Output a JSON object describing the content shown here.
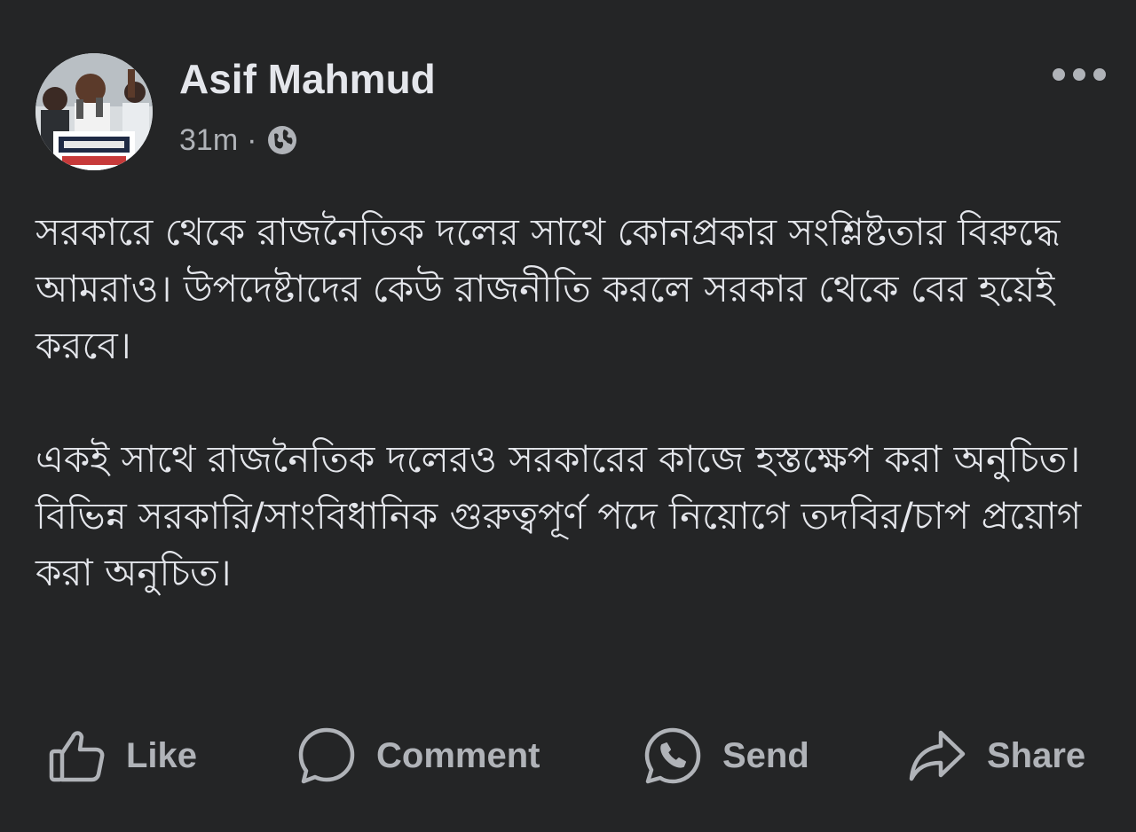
{
  "post": {
    "author": {
      "name": "Asif Mahmud",
      "avatar_alt": "profile photo"
    },
    "timestamp": "31m",
    "separator": "·",
    "audience_icon": "globe-icon",
    "more_icon": "more-horizontal-icon",
    "paragraphs": [
      "সরকারে থেকে রাজনৈতিক দলের সাথে কোনপ্রকার সংশ্লিষ্টতার বিরুদ্ধে আমরাও। উপদেষ্টাদের কেউ রাজনীতি করলে সরকার থেকে বের হয়েই করবে।",
      "একই সাথে রাজনৈতিক দলেরও সরকারের কাজে হস্তক্ষেপ করা অনুচিত। বিভিন্ন সরকারি/সাংবিধানিক গুরুত্বপূর্ণ পদে নিয়োগে তদবির/চাপ প্রয়োগ করা অনুচিত।"
    ],
    "actions": {
      "like": "Like",
      "comment": "Comment",
      "send": "Send",
      "share": "Share"
    }
  },
  "colors": {
    "background": "#242526",
    "primary_text": "#e4e6eb",
    "secondary_text": "#b0b3b8"
  }
}
